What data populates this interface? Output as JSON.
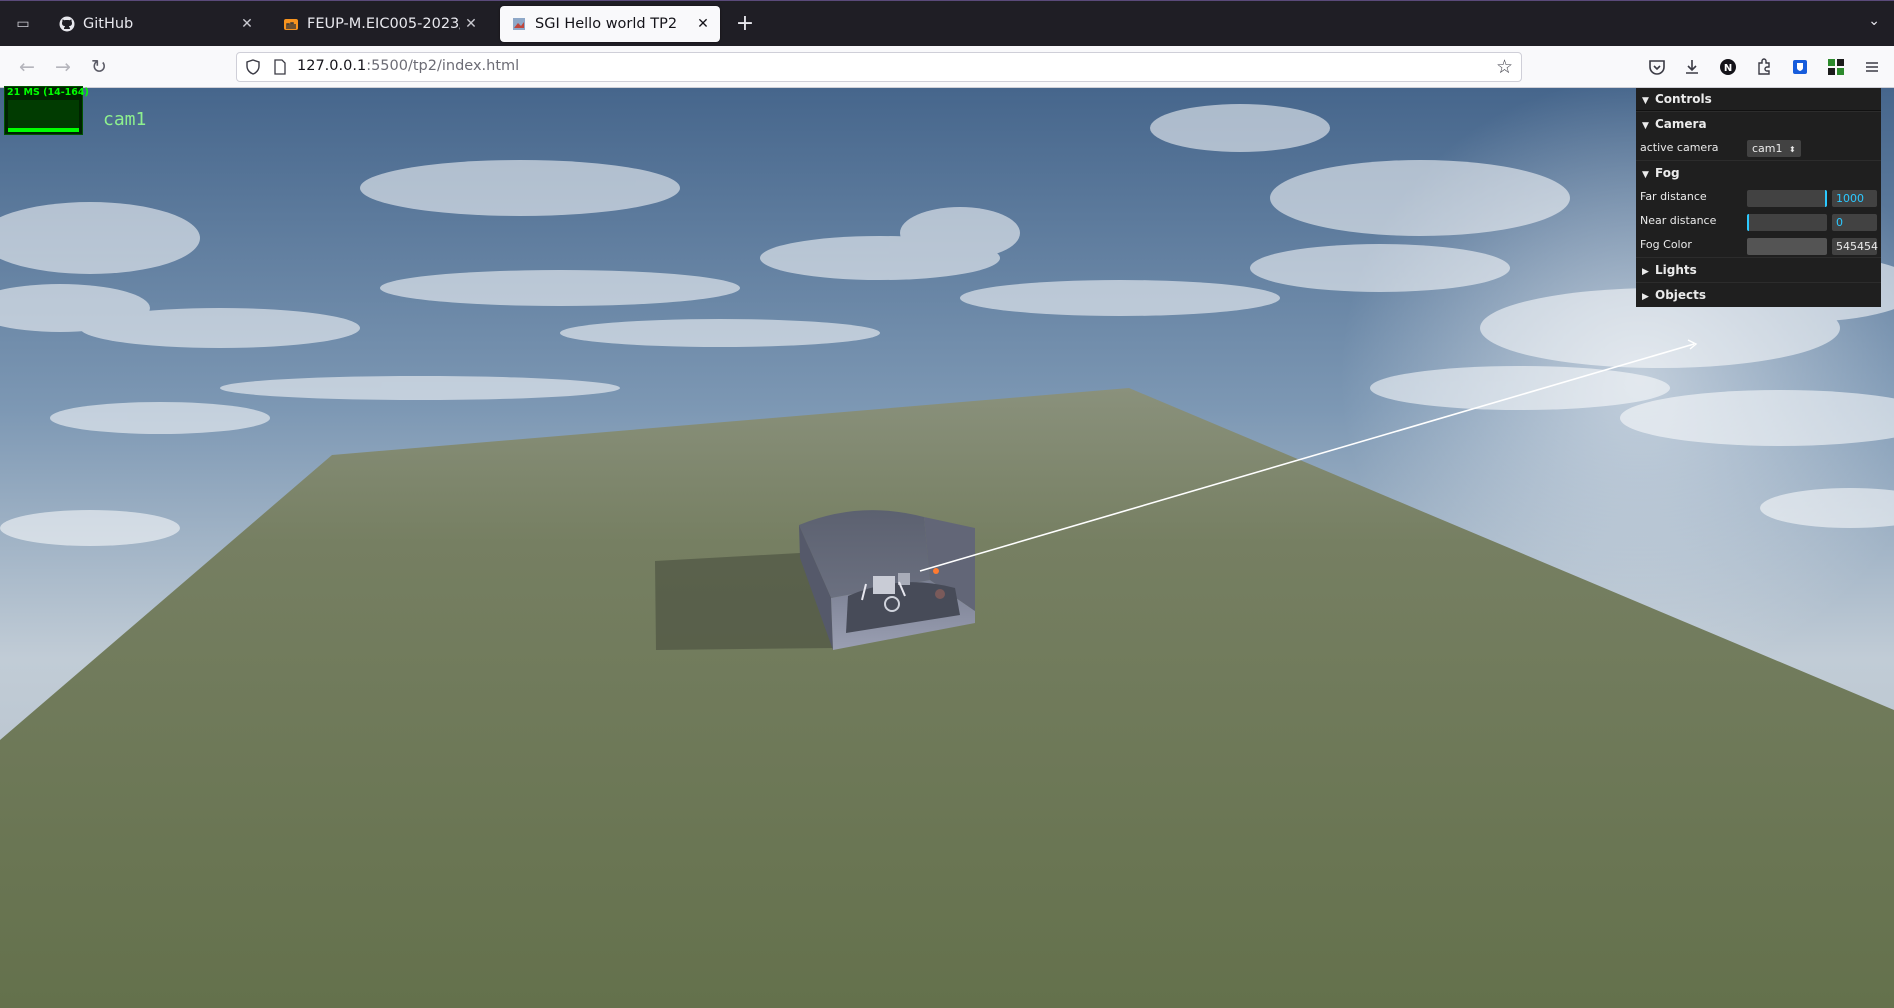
{
  "browser": {
    "tabs": [
      {
        "title": "GitHub",
        "icon": "github-icon",
        "active": false
      },
      {
        "title": "FEUP-M.EIC005-2023/2024",
        "icon": "moodle-icon",
        "active": false
      },
      {
        "title": "SGI Hello world TP2",
        "icon": "page-icon",
        "active": true
      }
    ],
    "url": {
      "host": "127.0.0.1",
      "path": ":5500/tp2/index.html"
    }
  },
  "scene": {
    "stats": {
      "text": "21 MS (14-164)"
    },
    "camera_label": "cam1",
    "colors": {
      "sky_top": "#4a6b90",
      "sky_horizon": "#c3cdd6",
      "ground": "#6e7b57",
      "accent": "#2cc9ff"
    }
  },
  "gui": {
    "title": "Controls",
    "camera": {
      "folder": "Camera",
      "active_camera_label": "active camera",
      "active_camera_value": "cam1"
    },
    "fog": {
      "folder": "Fog",
      "far_label": "Far distance",
      "far_value": "1000",
      "far_fraction": 1.0,
      "near_label": "Near distance",
      "near_value": "0",
      "near_fraction": 0.0,
      "color_label": "Fog Color",
      "color_value": "545454"
    },
    "lights": {
      "folder": "Lights"
    },
    "objects": {
      "folder": "Objects"
    }
  }
}
